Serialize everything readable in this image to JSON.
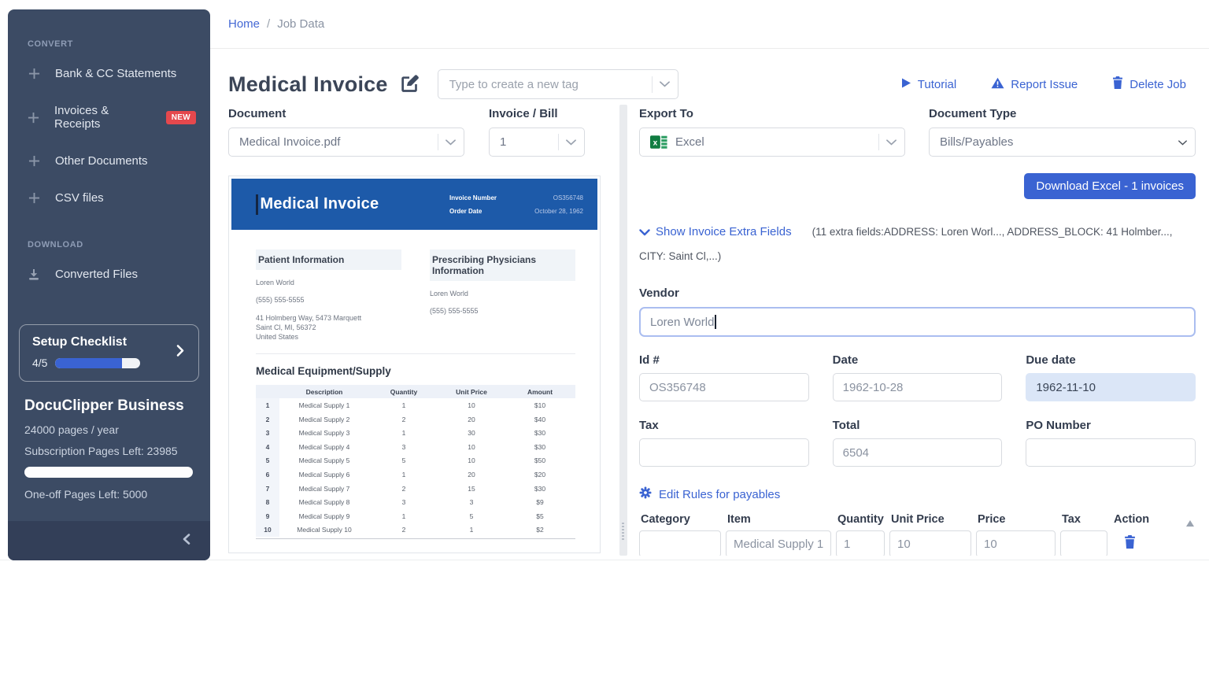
{
  "sidebar": {
    "convert_label": "CONVERT",
    "convert_items": [
      {
        "label": "Bank & CC Statements",
        "badge": ""
      },
      {
        "label": "Invoices & Receipts",
        "badge": "NEW"
      },
      {
        "label": "Other Documents",
        "badge": ""
      },
      {
        "label": "CSV files",
        "badge": ""
      }
    ],
    "download_label": "DOWNLOAD",
    "converted_files_label": "Converted Files",
    "checklist": {
      "title": "Setup Checklist",
      "progress": "4/5",
      "progress_pct": 78
    },
    "plan": {
      "name": "DocuClipper Business",
      "quota": "24000 pages / year",
      "subscription_left": "Subscription Pages Left: 23985",
      "oneoff_left": "One-off Pages Left: 5000"
    }
  },
  "breadcrumb": {
    "home": "Home",
    "sep": "/",
    "current": "Job Data"
  },
  "header": {
    "title": "Medical Invoice",
    "tag_placeholder": "Type to create a new tag",
    "tutorial": "Tutorial",
    "report_issue": "Report Issue",
    "delete_job": "Delete Job"
  },
  "controls": {
    "document_label": "Document",
    "document_value": "Medical Invoice.pdf",
    "invoice_bill_label": "Invoice / Bill",
    "invoice_bill_value": "1",
    "export_to_label": "Export To",
    "export_to_value": "Excel",
    "document_type_label": "Document Type",
    "document_type_value": "Bills/Payables",
    "download_button": "Download Excel - 1 invoices"
  },
  "preview": {
    "doc_title": "Medical Invoice",
    "invoice_number_label": "Invoice Number",
    "invoice_number": "OS356748",
    "order_date_label": "Order Date",
    "order_date": "October 28, 1962",
    "patient_heading": "Patient Information",
    "patient_name": "Loren World",
    "patient_phone": "(555) 555-5555",
    "patient_address1": "41 Holmberg Way, 5473 Marquett",
    "patient_address2": "Saint Cl, MI, 56372",
    "patient_address3": "United States",
    "physician_heading": "Prescribing Physicians Information",
    "physician_name": "Loren World",
    "physician_phone": "(555) 555-5555",
    "table_heading": "Medical Equipment/Supply",
    "table": {
      "columns": [
        "Description",
        "Quantity",
        "Unit Price",
        "Amount"
      ],
      "rows": [
        [
          "1",
          "Medical Supply 1",
          "1",
          "10",
          "$10"
        ],
        [
          "2",
          "Medical Supply 2",
          "2",
          "20",
          "$40"
        ],
        [
          "3",
          "Medical Supply 3",
          "1",
          "30",
          "$30"
        ],
        [
          "4",
          "Medical Supply 4",
          "3",
          "10",
          "$30"
        ],
        [
          "5",
          "Medical Supply 5",
          "5",
          "10",
          "$50"
        ],
        [
          "6",
          "Medical Supply 6",
          "1",
          "20",
          "$20"
        ],
        [
          "7",
          "Medical Supply 7",
          "2",
          "15",
          "$30"
        ],
        [
          "8",
          "Medical Supply 8",
          "3",
          "3",
          "$9"
        ],
        [
          "9",
          "Medical Supply 9",
          "1",
          "5",
          "$5"
        ],
        [
          "10",
          "Medical Supply 10",
          "2",
          "1",
          "$2"
        ]
      ]
    }
  },
  "fields": {
    "extra_toggle": "Show Invoice Extra Fields",
    "extra_summary": "(11 extra fields:ADDRESS: Loren Worl..., ADDRESS_BLOCK: 41 Holmber..., CITY: Saint Cl,...)",
    "vendor_label": "Vendor",
    "vendor_value": "Loren World",
    "id_label": "Id #",
    "id_value": "OS356748",
    "date_label": "Date",
    "date_value": "1962-10-28",
    "due_label": "Due date",
    "due_value": "1962-11-10",
    "tax_label": "Tax",
    "tax_value": "",
    "total_label": "Total",
    "total_value": "6504",
    "po_label": "PO Number",
    "po_value": "",
    "edit_rules": "Edit Rules for payables",
    "line_items": {
      "columns": [
        "Category",
        "Item",
        "Quantity",
        "Unit Price",
        "Price",
        "Tax",
        "Action"
      ],
      "row1": {
        "category": "",
        "item": "Medical Supply 1",
        "quantity": "1",
        "unit_price": "10",
        "price": "10",
        "tax": ""
      }
    }
  },
  "colors": {
    "accent_blue": "#3a63d2",
    "sidebar_bg": "#3c4b64",
    "pdf_header_blue": "#1d5aa9",
    "badge_red": "#e5484d",
    "due_highlight": "#dbe6f7"
  }
}
